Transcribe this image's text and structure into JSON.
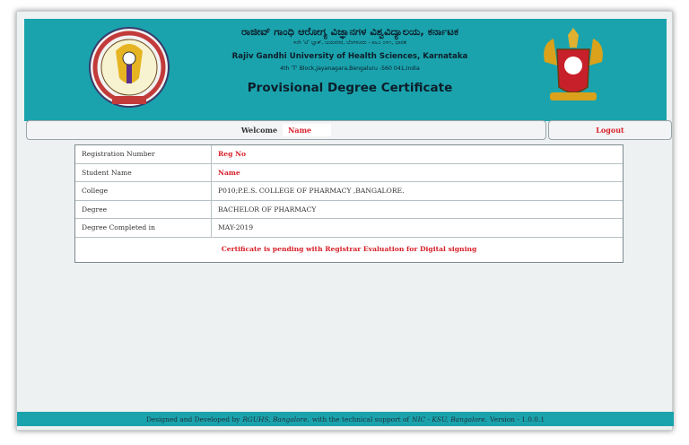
{
  "header": {
    "kannada_title": "ರಾಜೀವ್ ಗಾಂಧಿ ಆರೋಗ್ಯ ವಿಜ್ಞಾನಗಳ ವಿಶ್ವವಿದ್ಯಾಲಯ, ಕರ್ನಾಟಕ",
    "kannada_address": "೪ನೇ 'ಟಿ' ಬ್ಲಾಕ್, ಜಯನಗರ, ಬೆಂಗಳೂರು - ೫೬೦ ೦೪೧, ಭಾರತ",
    "university_name": "Rajiv Gandhi University of Health Sciences, Karnataka",
    "address": "4th 'T' Block,Jayanagara,Bengaluru -560 041,India",
    "page_title": "Provisional Degree Certificate",
    "colors": {
      "banner": "#1aa3ad",
      "accent_red": "#d8202a"
    }
  },
  "welcome": {
    "label": "Welcome",
    "name": "Name"
  },
  "logout_label": "Logout",
  "details": {
    "rows": [
      {
        "label": "Registration Number",
        "value": "Reg No"
      },
      {
        "label": "Student Name",
        "value": "Name"
      },
      {
        "label": "College",
        "value": "P010;P.E.S. COLLEGE OF PHARMACY ,BANGALORE."
      },
      {
        "label": "Degree",
        "value": "BACHELOR OF PHARMACY"
      },
      {
        "label": "Degree Completed in",
        "value": "MAY-2019"
      }
    ],
    "status": "Certificate is pending with Registrar Evaluation for Digital signing"
  },
  "footer": {
    "prefix": "Designed and Developed by",
    "developer": "RGUHS, Bangalore.",
    "middle": "with the technical support of",
    "support": "NIC - KSU, Bangalore.",
    "version": "Version - 1.0.0.1"
  }
}
